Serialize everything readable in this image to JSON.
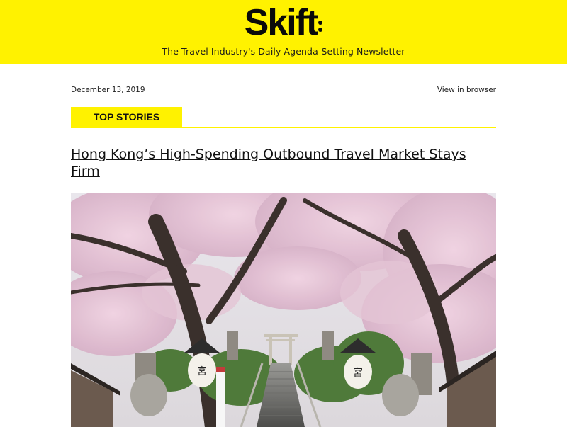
{
  "header": {
    "logo_text": "Skift",
    "tagline": "The Travel Industry's Daily Agenda-Setting Newsletter"
  },
  "meta": {
    "date": "December 13, 2019",
    "view_in_browser": "View in browser"
  },
  "section": {
    "label": "TOP STORIES"
  },
  "article": {
    "headline": "Hong Kong’s High-Spending Outbound Travel Market Stays Firm",
    "image_alt": "Cherry blossom trees over stone stairway leading to a shrine gate with lanterns"
  },
  "colors": {
    "brand_yellow": "#fff200",
    "text": "#111111"
  }
}
